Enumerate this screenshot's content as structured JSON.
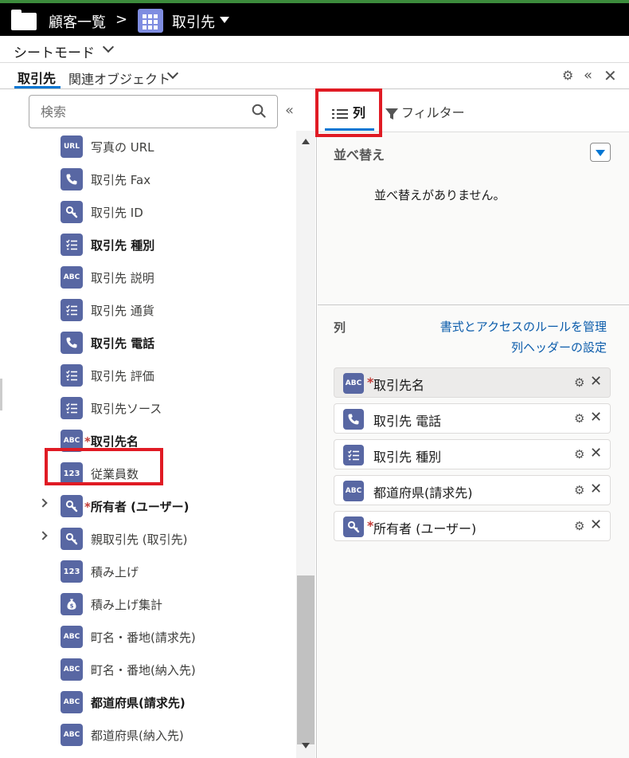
{
  "breadcrumb": {
    "root": "顧客一覧",
    "separator": ">",
    "object": "取引先"
  },
  "mode": {
    "label": "シートモード"
  },
  "tabs": {
    "primary": "取引先",
    "related": "関連オブジェクト"
  },
  "search": {
    "placeholder": "検索"
  },
  "fields": [
    {
      "icon": "URL",
      "label": "写真の URL",
      "bold": false,
      "required": false,
      "expandable": false
    },
    {
      "icon": "phone-icon",
      "label": "取引先 Fax",
      "bold": false,
      "required": false,
      "expandable": false
    },
    {
      "icon": "lookup-icon",
      "label": "取引先 ID",
      "bold": false,
      "required": false,
      "expandable": false
    },
    {
      "icon": "picklist-icon",
      "label": "取引先 種別",
      "bold": true,
      "required": false,
      "expandable": false
    },
    {
      "icon": "ABC",
      "label": "取引先 説明",
      "bold": false,
      "required": false,
      "expandable": false
    },
    {
      "icon": "picklist-icon",
      "label": "取引先 通貨",
      "bold": false,
      "required": false,
      "expandable": false
    },
    {
      "icon": "phone-icon",
      "label": "取引先 電話",
      "bold": true,
      "required": false,
      "expandable": false
    },
    {
      "icon": "picklist-icon",
      "label": "取引先 評価",
      "bold": false,
      "required": false,
      "expandable": false
    },
    {
      "icon": "picklist-icon",
      "label": "取引先ソース",
      "bold": false,
      "required": false,
      "expandable": false
    },
    {
      "icon": "ABC",
      "label": "取引先名",
      "bold": true,
      "required": true,
      "expandable": false
    },
    {
      "icon": "123",
      "label": "従業員数",
      "bold": false,
      "required": false,
      "expandable": false
    },
    {
      "icon": "lookup-icon",
      "label": "所有者 (ユーザー)",
      "bold": true,
      "required": true,
      "expandable": true
    },
    {
      "icon": "lookup-icon",
      "label": "親取引先 (取引先)",
      "bold": false,
      "required": false,
      "expandable": true
    },
    {
      "icon": "123",
      "label": "積み上げ",
      "bold": false,
      "required": false,
      "expandable": false
    },
    {
      "icon": "money-icon",
      "label": "積み上げ集計",
      "bold": false,
      "required": false,
      "expandable": false
    },
    {
      "icon": "ABC",
      "label": "町名・番地(請求先)",
      "bold": false,
      "required": false,
      "expandable": false
    },
    {
      "icon": "ABC",
      "label": "町名・番地(納入先)",
      "bold": false,
      "required": false,
      "expandable": false
    },
    {
      "icon": "ABC",
      "label": "都道府県(請求先)",
      "bold": true,
      "required": false,
      "expandable": false
    },
    {
      "icon": "ABC",
      "label": "都道府県(納入先)",
      "bold": false,
      "required": false,
      "expandable": false
    }
  ],
  "right": {
    "tab_columns": "列",
    "tab_filter": "フィルター",
    "sort_title": "並べ替え",
    "sort_empty": "並べ替えがありません。",
    "columns_title": "列",
    "link_format": "書式とアクセスのルールを管理",
    "link_header": "列ヘッダーの設定",
    "columns": [
      {
        "icon": "ABC",
        "label": "取引先名",
        "required": true
      },
      {
        "icon": "phone-icon",
        "label": "取引先 電話",
        "required": false
      },
      {
        "icon": "picklist-icon",
        "label": "取引先 種別",
        "required": false
      },
      {
        "icon": "ABC",
        "label": "都道府県(請求先)",
        "required": false
      },
      {
        "icon": "lookup-icon",
        "label": "所有者 (ユーザー)",
        "required": true
      }
    ]
  },
  "colors": {
    "accent": "#0176d3",
    "icon_bg": "#5867a3",
    "highlight": "#e01b24",
    "link": "#0b5cab"
  }
}
